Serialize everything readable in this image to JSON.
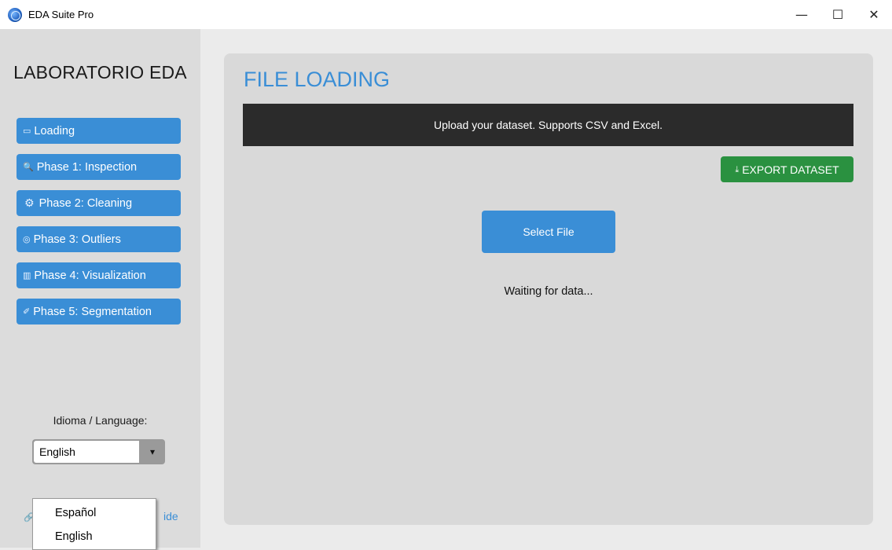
{
  "window": {
    "title": "EDA Suite Pro",
    "controls": {
      "minimize": "—",
      "maximize": "☐",
      "close": "✕"
    }
  },
  "sidebar": {
    "brand": "LABORATORIO EDA",
    "items": [
      {
        "label": "Loading",
        "icon": "folder-icon",
        "glyph": "▭"
      },
      {
        "label": "Phase 1: Inspection",
        "icon": "magnifier-icon",
        "glyph": "🔍"
      },
      {
        "label": "Phase 2: Cleaning",
        "icon": "gear-icon",
        "glyph": "⚙"
      },
      {
        "label": "Phase 3: Outliers",
        "icon": "brain-icon",
        "glyph": "◎"
      },
      {
        "label": "Phase 4: Visualization",
        "icon": "bar-chart-icon",
        "glyph": "▥"
      },
      {
        "label": "Phase 5: Segmentation",
        "icon": "syringe-icon",
        "glyph": "✐"
      }
    ],
    "language_label": "Idioma / Language:",
    "language_selected": "English",
    "language_options": [
      "Español",
      "English"
    ],
    "guide_link_visible_start": "🔗",
    "guide_link_visible_end": "ide"
  },
  "main": {
    "title": "FILE LOADING",
    "banner": "Upload your dataset. Supports CSV and Excel.",
    "export_button": "EXPORT DATASET",
    "select_button": "Select File",
    "status": "Waiting for data..."
  },
  "colors": {
    "accent": "#3a8ed6",
    "export": "#2a9140",
    "banner_bg": "#2b2b2b",
    "sidebar_bg": "#dcdcdc",
    "panel_bg": "#d9d9d9"
  }
}
